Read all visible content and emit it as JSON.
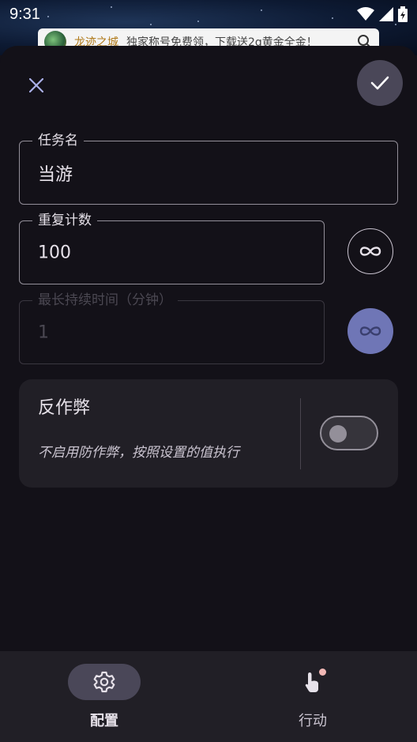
{
  "status_bar": {
    "time": "9:31",
    "icons": [
      "wifi-icon",
      "signal-icon",
      "battery-icon"
    ]
  },
  "ad_banner": {
    "title": "龙迹之城",
    "text": "独家称号免费领，下载送2g黄金全金！",
    "icon": "search-icon"
  },
  "dialog": {
    "close_icon": "close-icon",
    "confirm_icon": "check-icon",
    "fields": {
      "task_name": {
        "label": "任务名",
        "value": "当游"
      },
      "repeat_count": {
        "label": "重复计数",
        "value": "100"
      },
      "max_duration": {
        "label": "最长持续时间（分钟）",
        "value": "1",
        "enabled": false
      }
    },
    "anti_cheat": {
      "title": "反作弊",
      "description": "不启用防作弊，按照设置的值执行",
      "enabled": false
    }
  },
  "bottom_nav": {
    "items": [
      {
        "label": "配置",
        "icon": "gear-icon",
        "active": true
      },
      {
        "label": "行动",
        "icon": "touch-icon",
        "active": false,
        "badge": true
      }
    ]
  },
  "colors": {
    "background": "#131118",
    "surface": "#211f26",
    "accent_filled": "#6f76b6",
    "outline": "#938f99"
  }
}
